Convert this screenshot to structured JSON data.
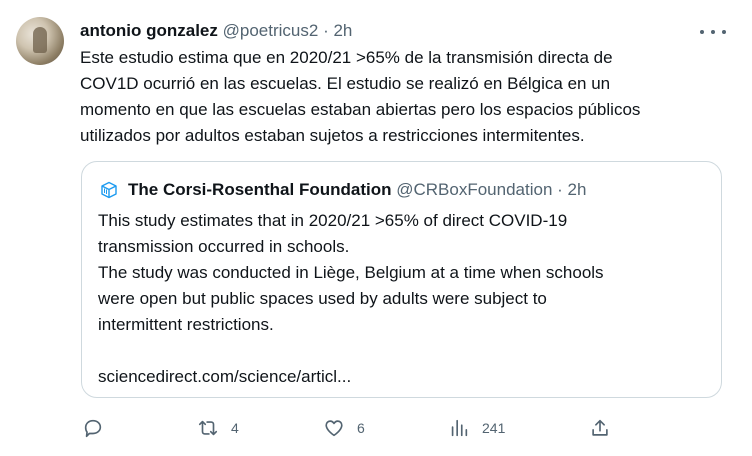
{
  "tweet": {
    "author_name": "antonio gonzalez",
    "handle": "@poetricus2",
    "separator": "·",
    "time": "2h",
    "lines": [
      "Este estudio estima que en 2020/21 >65% de la transmisión directa de",
      "COV1D ocurrió en las escuelas. El estudio se realizó en Bélgica en un",
      "momento en que las escuelas estaban abiertas pero los espacios públicos",
      "utilizados por adultos estaban sujetos a restricciones intermitentes."
    ]
  },
  "quote": {
    "author_name": "The Corsi-Rosenthal Foundation",
    "handle": "@CRBoxFoundation",
    "separator": "·",
    "time": "2h",
    "lines": [
      "This study estimates that in 2020/21 >65% of direct COVID-19",
      "transmission occurred in schools.",
      "The study was conducted in Liège, Belgium at a time when schools",
      "were open but public spaces used by adults were subject to",
      "intermittent restrictions.",
      "",
      "sciencedirect.com/science/articl..."
    ],
    "logo_icon": "cube-logo-icon"
  },
  "actions": {
    "reply": {
      "icon": "reply-icon",
      "count": ""
    },
    "retweet": {
      "icon": "retweet-icon",
      "count": "4"
    },
    "like": {
      "icon": "heart-icon",
      "count": "6"
    },
    "views": {
      "icon": "views-chart-icon",
      "count": "241"
    },
    "share": {
      "icon": "share-icon",
      "count": ""
    }
  },
  "colors": {
    "text": "#0f1419",
    "secondary": "#536471",
    "border": "#cfd9de",
    "logo": "#1d9bf0"
  }
}
